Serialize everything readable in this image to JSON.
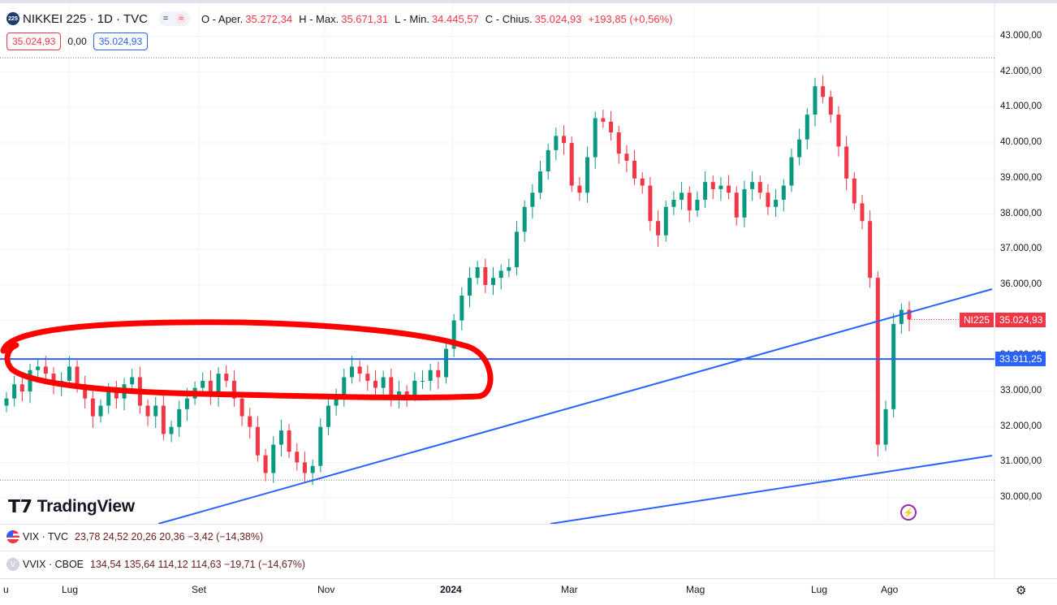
{
  "header": {
    "badge": "225",
    "title": "NIKKEI 225 · 1D · TVC",
    "pill_left": "=",
    "pill_right": "≈",
    "open_label": "O - Aper.",
    "open": "35.272,34",
    "high_label": "H - Max.",
    "high": "35.671,31",
    "low_label": "L - Min.",
    "low": "34.445,57",
    "close_label": "C - Chius.",
    "close": "35.024,93",
    "change": "+193,85 (+0,56%)"
  },
  "values_row": {
    "bid": "35.024,93",
    "spread": "0,00",
    "ask": "35.024,93"
  },
  "logo": {
    "text": "TradingView",
    "mark": "TV"
  },
  "indicators": [
    {
      "name": "VIX · TVC",
      "values": "23,78  24,52  20,26  20,36  −3,42 (−14,38%)"
    },
    {
      "name": "VVIX · CBOE",
      "badge": "V",
      "values": "134,54  135,64  114,12  114,63  −19,71 (−14,67%)"
    }
  ],
  "price_tags": {
    "symbol": "NI225",
    "last": "35.024,93",
    "hline": "33.911,25"
  },
  "colors": {
    "up": "#089981",
    "down": "#f23645",
    "line": "#2962ff",
    "marker": "#ff0000"
  },
  "chart_data": {
    "type": "candlestick",
    "title": "NIKKEI 225 · 1D · TVC",
    "ylim": [
      30000,
      43000
    ],
    "y_ticks": [
      "43.000,00",
      "42.000,00",
      "41.000,00",
      "40.000,00",
      "39.000,00",
      "38.000,00",
      "37.000,00",
      "36.000,00",
      "35.000,00",
      "34.000,00",
      "33.000,00",
      "32.000,00",
      "31.000,00",
      "30.000,00"
    ],
    "y_tick_values": [
      43000,
      42000,
      41000,
      40000,
      39000,
      38000,
      37000,
      36000,
      35000,
      34000,
      33000,
      32000,
      31000,
      30000
    ],
    "x_ticks": [
      "u",
      "Lug",
      "Set",
      "Nov",
      "2024",
      "Mar",
      "Mag",
      "Lug",
      "Ago"
    ],
    "closes": [
      32800,
      33200,
      33000,
      33600,
      33700,
      33500,
      33200,
      33300,
      33700,
      33200,
      32800,
      32300,
      32600,
      33000,
      32800,
      33200,
      33400,
      32600,
      32300,
      32600,
      31800,
      32000,
      32500,
      32800,
      33100,
      33300,
      32900,
      33500,
      33300,
      32800,
      32300,
      32000,
      31200,
      30700,
      31500,
      31900,
      31300,
      31000,
      30700,
      30900,
      32000,
      32600,
      32900,
      33400,
      33700,
      33500,
      33300,
      33100,
      33400,
      32800,
      33000,
      32900,
      33300,
      33300,
      33600,
      33400,
      34200,
      35000,
      35700,
      36200,
      36500,
      36000,
      36200,
      36400,
      36500,
      37500,
      38200,
      38600,
      39200,
      39800,
      40200,
      40000,
      38800,
      38600,
      39600,
      40700,
      40600,
      40300,
      39700,
      39500,
      39000,
      38800,
      37800,
      37400,
      38200,
      38400,
      38600,
      38100,
      38400,
      38900,
      38700,
      38800,
      38600,
      37900,
      38700,
      38900,
      38600,
      38200,
      38400,
      38800,
      39600,
      40100,
      40800,
      41600,
      41300,
      40800,
      39900,
      39000,
      38300,
      37800,
      36200,
      31500,
      32500,
      34900,
      35300,
      35025
    ],
    "horizontal_line": 33911.25,
    "last_price": 35024.93,
    "period_high": 42400,
    "period_low": 30500
  }
}
